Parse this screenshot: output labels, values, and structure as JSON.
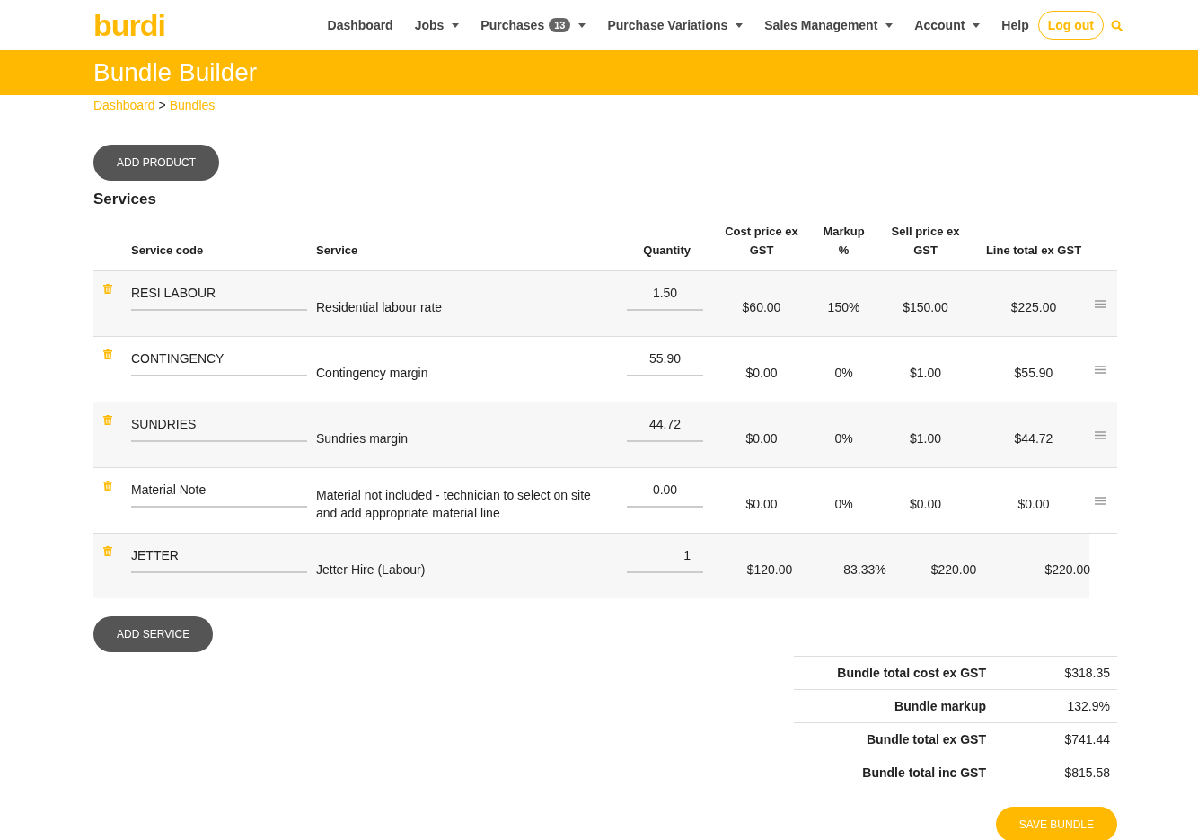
{
  "logo": "burdi",
  "nav": [
    {
      "label": "Dashboard",
      "dropdown": false
    },
    {
      "label": "Jobs",
      "dropdown": true
    },
    {
      "label": "Purchases",
      "badge": "13",
      "dropdown": true
    },
    {
      "label": "Purchase Variations",
      "dropdown": true
    },
    {
      "label": "Sales Management",
      "dropdown": true
    },
    {
      "label": "Account",
      "dropdown": true
    },
    {
      "label": "Help",
      "dropdown": false
    }
  ],
  "logout": "Log out",
  "page_title": "Bundle Builder",
  "breadcrumb": [
    {
      "label": "Dashboard"
    },
    {
      "label": "Bundles"
    }
  ],
  "breadcrumb_separator": ">",
  "add_product": "ADD PRODUCT",
  "section_title": "Services",
  "columns": [
    "Service code",
    "Service",
    "Quantity",
    "Cost price ex GST",
    "Markup %",
    "Sell price ex GST",
    "Line total ex GST"
  ],
  "rows": [
    {
      "code": "RESI LABOUR",
      "service": "Residential labour rate",
      "quantity": "1.50",
      "cost": "$60.00",
      "markup": "150%",
      "sell": "$150.00",
      "total": "$225.00",
      "handle": true
    },
    {
      "code": "CONTINGENCY",
      "service": "Contingency margin",
      "quantity": "55.90",
      "cost": "$0.00",
      "markup": "0%",
      "sell": "$1.00",
      "total": "$55.90",
      "handle": true
    },
    {
      "code": "SUNDRIES",
      "service": "Sundries margin",
      "quantity": "44.72",
      "cost": "$0.00",
      "markup": "0%",
      "sell": "$1.00",
      "total": "$44.72",
      "handle": true
    },
    {
      "code": "Material Note",
      "service": "Material not included - technician to select on site and add appropriate material line",
      "quantity": "0.00",
      "cost": "$0.00",
      "markup": "0%",
      "sell": "$0.00",
      "total": "$0.00",
      "handle": true
    },
    {
      "code": "JETTER",
      "service": "Jetter Hire (Labour)",
      "quantity": "1",
      "cost": "$120.00",
      "markup": "83.33%",
      "sell": "$220.00",
      "total": "$220.00",
      "handle": false
    }
  ],
  "add_service": "ADD SERVICE",
  "totals": [
    {
      "label": "Bundle total cost ex GST",
      "value": "$318.35"
    },
    {
      "label": "Bundle markup",
      "value": "132.9%"
    },
    {
      "label": "Bundle total ex GST",
      "value": "$741.44"
    },
    {
      "label": "Bundle total inc GST",
      "value": "$815.58"
    }
  ],
  "save": "SAVE BUNDLE"
}
